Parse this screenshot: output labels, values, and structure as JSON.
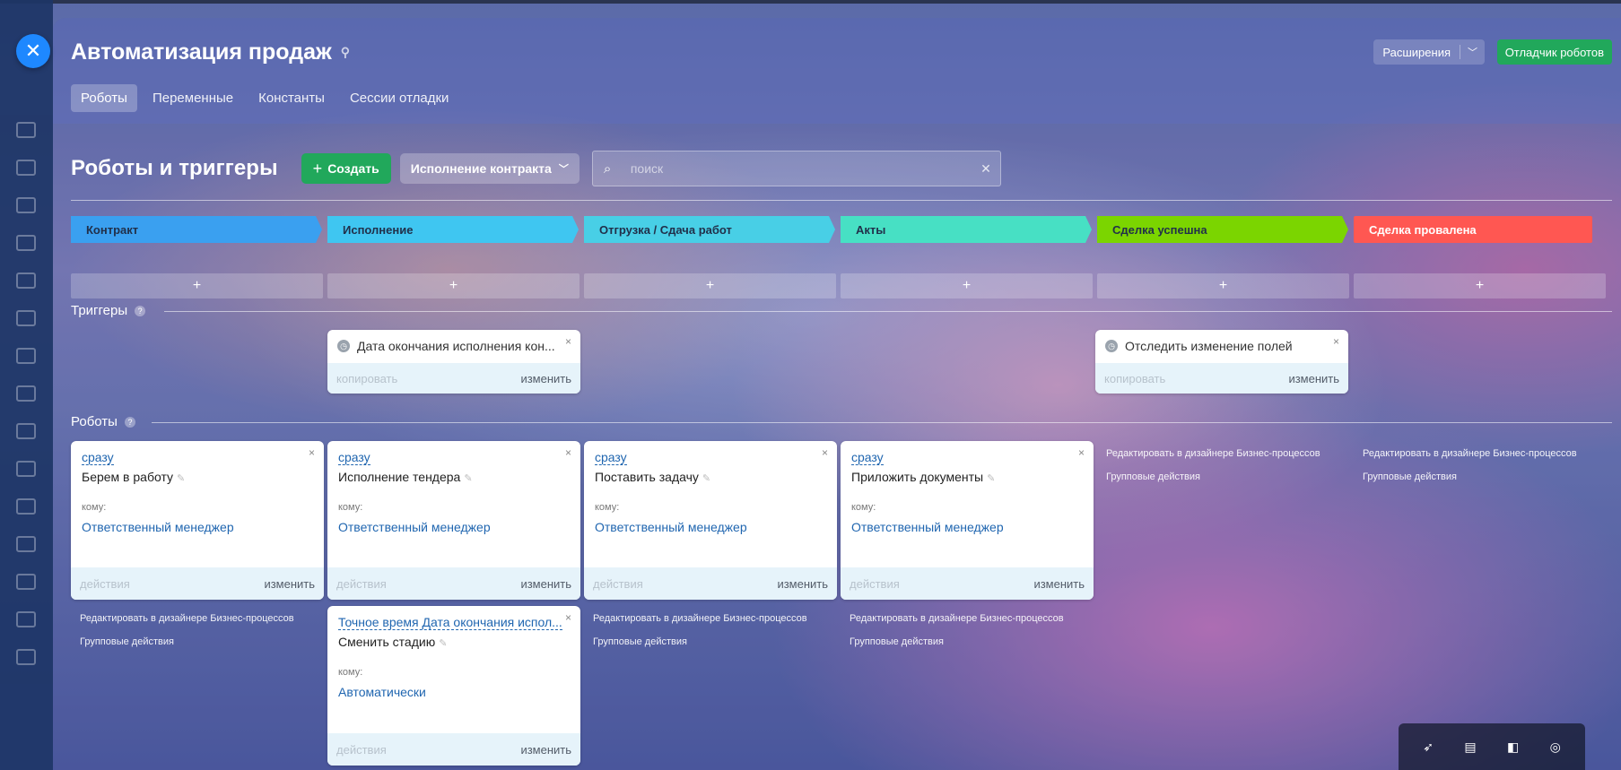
{
  "window": {
    "title": "Автоматизация продаж",
    "close_label": "✕"
  },
  "header": {
    "extensions_label": "Расширения",
    "debugger_label": "Отладчик роботов"
  },
  "tabs": [
    {
      "label": "Роботы",
      "active": true
    },
    {
      "label": "Переменные"
    },
    {
      "label": "Константы"
    },
    {
      "label": "Сессии отладки"
    }
  ],
  "toolbar": {
    "heading": "Роботы и триггеры",
    "create_label": "Создать",
    "pipeline_label": "Исполнение контракта",
    "search_placeholder": "поиск"
  },
  "stages": [
    {
      "label": "Контракт",
      "color": "#3aa0f0"
    },
    {
      "label": "Исполнение",
      "color": "#3fc6f1"
    },
    {
      "label": "Отгрузка / Сдача работ",
      "color": "#48cfe6"
    },
    {
      "label": "Акты",
      "color": "#47e0c4"
    },
    {
      "label": "Сделка успешна",
      "color": "#7bd500"
    },
    {
      "label": "Сделка провалена",
      "color": "#ff5752"
    }
  ],
  "add_symbol": "+",
  "sections": {
    "triggers": "Триггеры",
    "robots": "Роботы",
    "help": "?"
  },
  "common": {
    "copy": "копировать",
    "edit": "изменить",
    "actions": "действия",
    "to": "кому:",
    "close": "×",
    "bp_designer": "Редактировать в дизайнере Бизнес-процессов",
    "group_actions": "Групповые действия"
  },
  "triggers": [
    {
      "stage": 1,
      "title": "Дата окончания исполнения кон..."
    },
    {
      "stage": 4,
      "title": "Отследить изменение полей"
    }
  ],
  "robots": [
    {
      "stage": 0,
      "when": "сразу",
      "name": "Берем в работу",
      "who": "Ответственный менеджер"
    },
    {
      "stage": 1,
      "when": "сразу",
      "name": "Исполнение тендера",
      "who": "Ответственный менеджер"
    },
    {
      "stage": 1,
      "when": "Точное время Дата окончания испол...",
      "name": "Сменить стадию",
      "who": "Автоматически"
    },
    {
      "stage": 2,
      "when": "сразу",
      "name": "Поставить задачу",
      "who": "Ответственный менеджер"
    },
    {
      "stage": 3,
      "when": "сразу",
      "name": "Приложить документы",
      "who": "Ответственный менеджер"
    }
  ],
  "tray": {
    "icons": [
      "cursor-icon",
      "clipboard-icon",
      "app-icon",
      "chat-icon"
    ]
  }
}
